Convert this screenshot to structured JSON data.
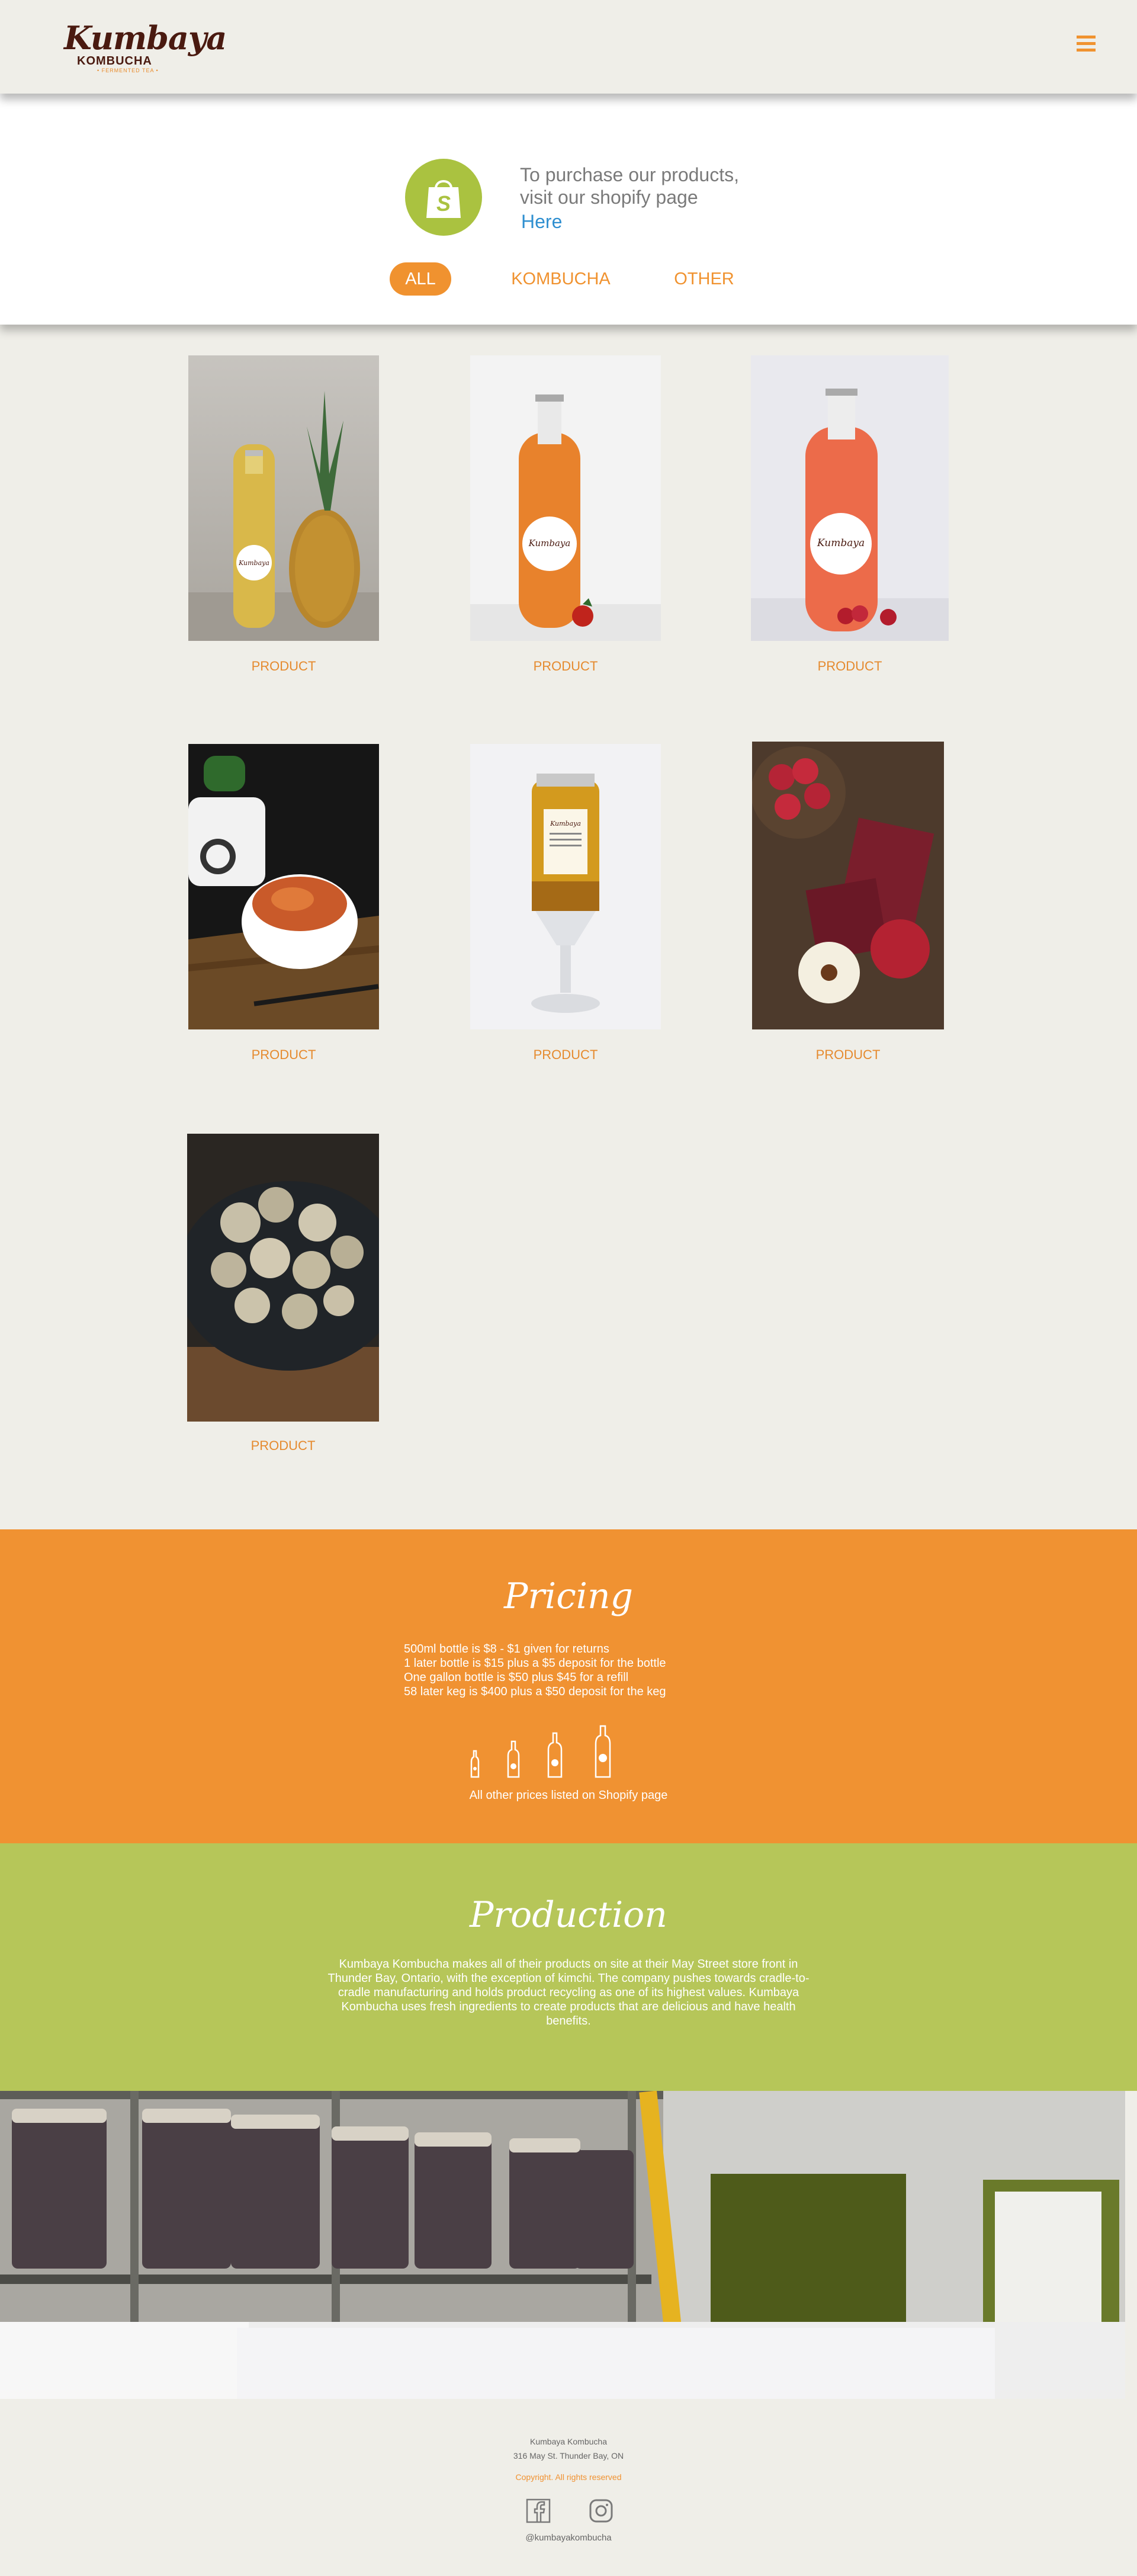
{
  "header": {
    "logo_script": "Kumbaya",
    "logo_sub": "KOMBUCHA",
    "logo_tag": "• FERMENTED TEA •",
    "menu_icon": "hamburger-menu-icon"
  },
  "shop": {
    "icon": "shopify-bag-icon",
    "line1": "To purchase our products,",
    "line2": "visit our shopify page",
    "link": "Here"
  },
  "filters": [
    "ALL",
    "KOMBUCHA",
    "OTHER"
  ],
  "products": [
    {
      "label": "PRODUCT",
      "image": "pineapple kombucha bottle"
    },
    {
      "label": "PRODUCT",
      "image": "strawberry kombucha bottle"
    },
    {
      "label": "PRODUCT",
      "image": "raspberry kombucha bottle"
    },
    {
      "label": "PRODUCT",
      "image": "kimchi bowl"
    },
    {
      "label": "PRODUCT",
      "image": "jar on glass stand"
    },
    {
      "label": "PRODUCT",
      "image": "raspberries and fruit leather"
    },
    {
      "label": "PRODUCT",
      "image": "plate of snacks"
    }
  ],
  "pricing": {
    "title": "Pricing",
    "lines": [
      "500ml bottle is $8 - $1 given for returns",
      "1 later bottle is $15 plus  a $5 deposit for the bottle",
      "One gallon bottle is $50 plus $45 for a refill",
      "58 later keg is $400 plus a $50 deposit for the keg"
    ],
    "note": "All other prices listed on Shopify page"
  },
  "production": {
    "title": "Production",
    "text": "Kumbaya Kombucha makes all of their products on site at their May Street store front in Thunder Bay, Ontario, with the exception of kimchi. The company pushes towards cradle-to-cradle manufacturing and holds product recycling as one of its highest values. Kumbaya Kombucha uses fresh ingredients to create products that are delicious and have health benefits."
  },
  "footer": {
    "name": "Kumbaya Kombucha",
    "address": "316 May St. Thunder Bay, ON",
    "copyright": "Copyright. All rights reserved",
    "handle": "@kumbayakombucha",
    "icons": [
      "facebook-icon",
      "instagram-icon"
    ]
  },
  "colors": {
    "orange": "#f09232",
    "green": "#b6c659",
    "shopify_green": "#aac240",
    "link_blue": "#2f8fd0",
    "background": "#efeee8"
  }
}
